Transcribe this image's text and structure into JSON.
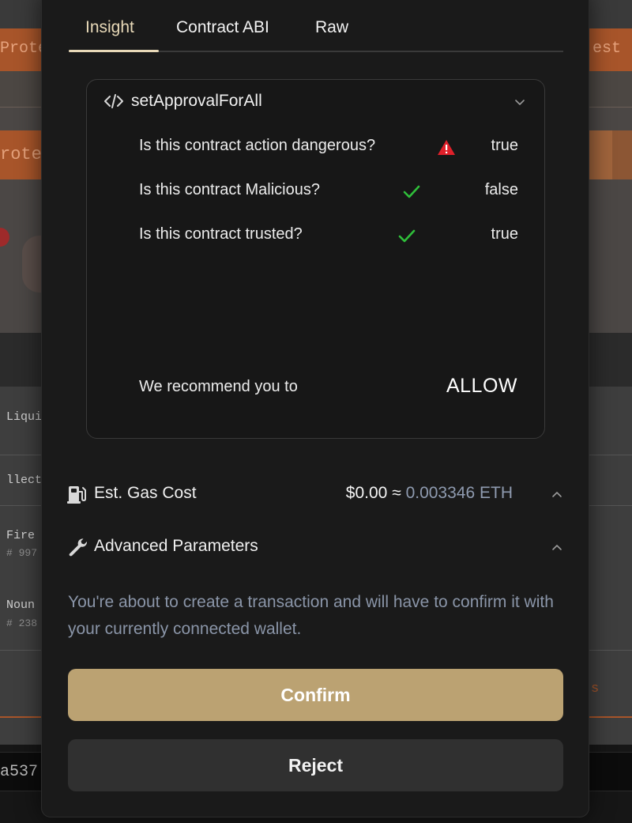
{
  "background": {
    "top_band_left": "Prote",
    "top_band_right": "est",
    "pill_left": "rote",
    "list_items": [
      {
        "label": "Liqui",
        "sub": ""
      },
      {
        "label": "llecti",
        "sub": ""
      },
      {
        "label": "Fire",
        "sub": "# 997"
      },
      {
        "label": "Noun",
        "sub": "# 238"
      }
    ],
    "right_text": "s",
    "bottom_field": "a537"
  },
  "modal": {
    "tabs": [
      {
        "label": "Insight",
        "active": true
      },
      {
        "label": "Contract ABI",
        "active": false
      },
      {
        "label": "Raw",
        "active": false
      }
    ],
    "insight": {
      "function_name": "setApprovalForAll",
      "icons": {
        "header": "code-icon",
        "expand": "chevron-down-icon"
      },
      "questions": [
        {
          "text": "Is this contract action dangerous?",
          "icon": "warning-icon",
          "value": "true"
        },
        {
          "text": "Is this contract Malicious?",
          "icon": "check-icon",
          "value": "false"
        },
        {
          "text": "Is this contract trusted?",
          "icon": "check-icon",
          "value": "true"
        }
      ],
      "recommend_label": "We recommend you to",
      "recommend_value": "ALLOW"
    },
    "gas": {
      "label": "Est. Gas Cost",
      "usd": "$0.00",
      "approx": "≈",
      "eth": "0.003346 ETH",
      "icon": "gas-pump-icon"
    },
    "advanced": {
      "label": "Advanced Parameters",
      "icon": "wrench-icon"
    },
    "notice": "You're about to create a transaction and will have to confirm it with your currently connected wallet.",
    "confirm_label": "Confirm",
    "reject_label": "Reject"
  },
  "colors": {
    "accent": "#bba272",
    "tab_active": "#e8d9b8",
    "warning": "#e0202a",
    "check": "#2fbf3a",
    "muted_text": "#8a95a8",
    "bg_orange": "#a8552a"
  }
}
